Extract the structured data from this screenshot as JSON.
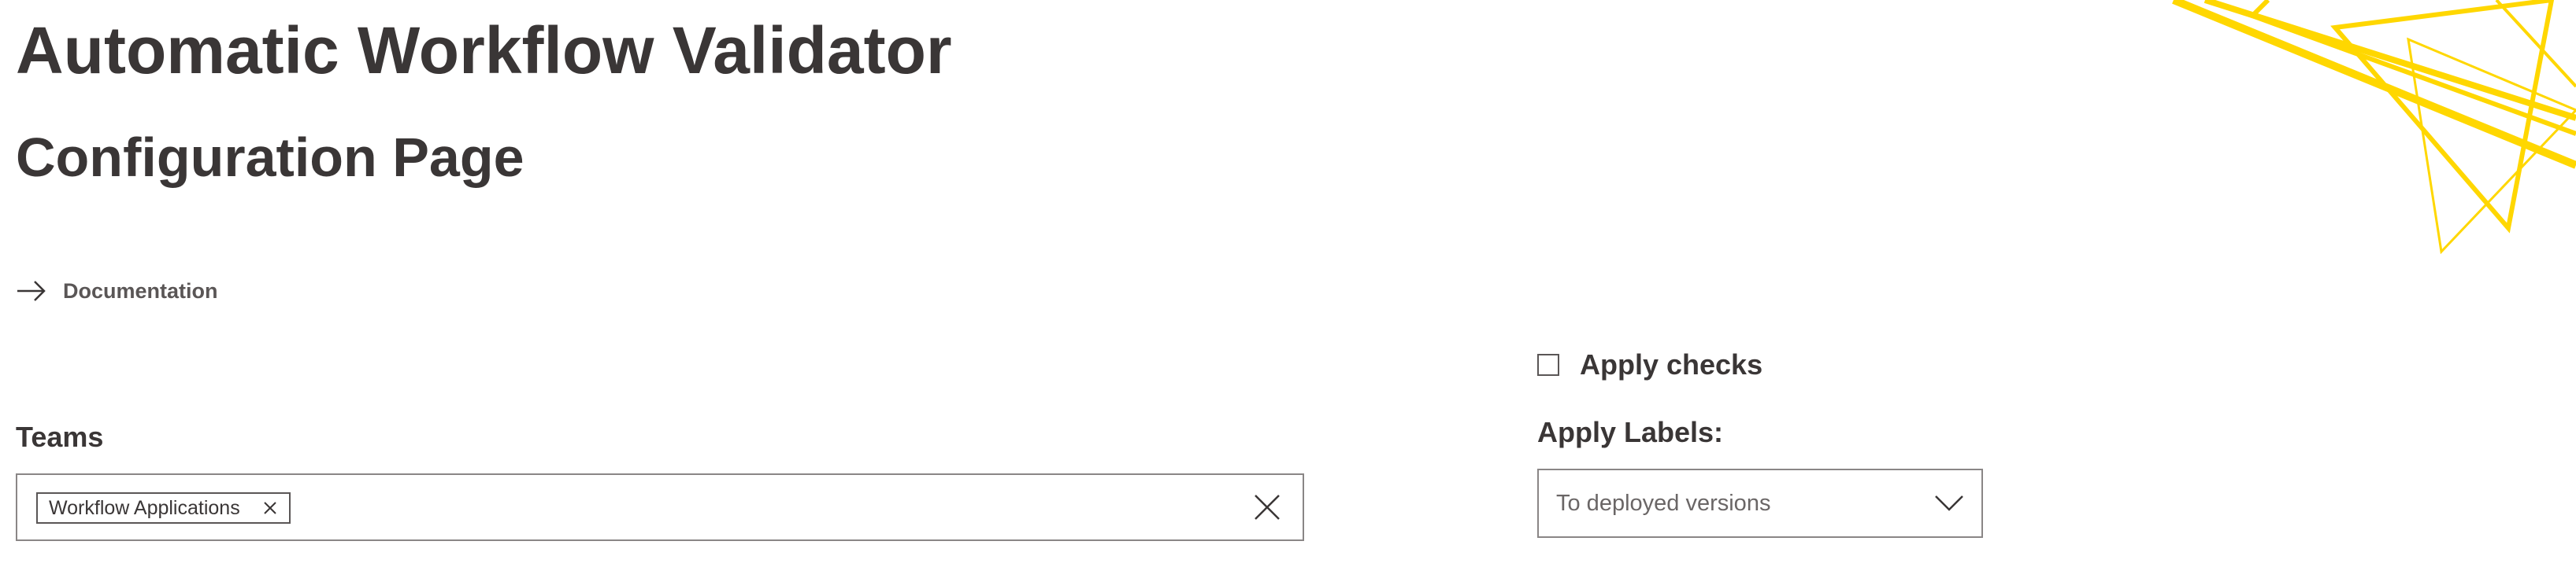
{
  "header": {
    "app_title": "Automatic Workflow Validator",
    "page_title": "Configuration Page"
  },
  "nav": {
    "documentation_link": "Documentation"
  },
  "form": {
    "teams": {
      "label": "Teams",
      "selected_chips": [
        "Workflow Applications"
      ]
    },
    "apply_checks": {
      "label": "Apply checks",
      "checked": false
    },
    "apply_labels": {
      "label": "Apply Labels:",
      "selected_value": "To deployed versions"
    }
  },
  "colors": {
    "text": "#3a3636",
    "border": "#8a8686",
    "brand_accent": "#ffd700"
  },
  "icons": {
    "documentation": "arrow-right-icon",
    "chip_remove": "close-icon",
    "clear_all": "close-icon",
    "select": "chevron-down-icon",
    "brand": "triangle-logo-icon"
  }
}
